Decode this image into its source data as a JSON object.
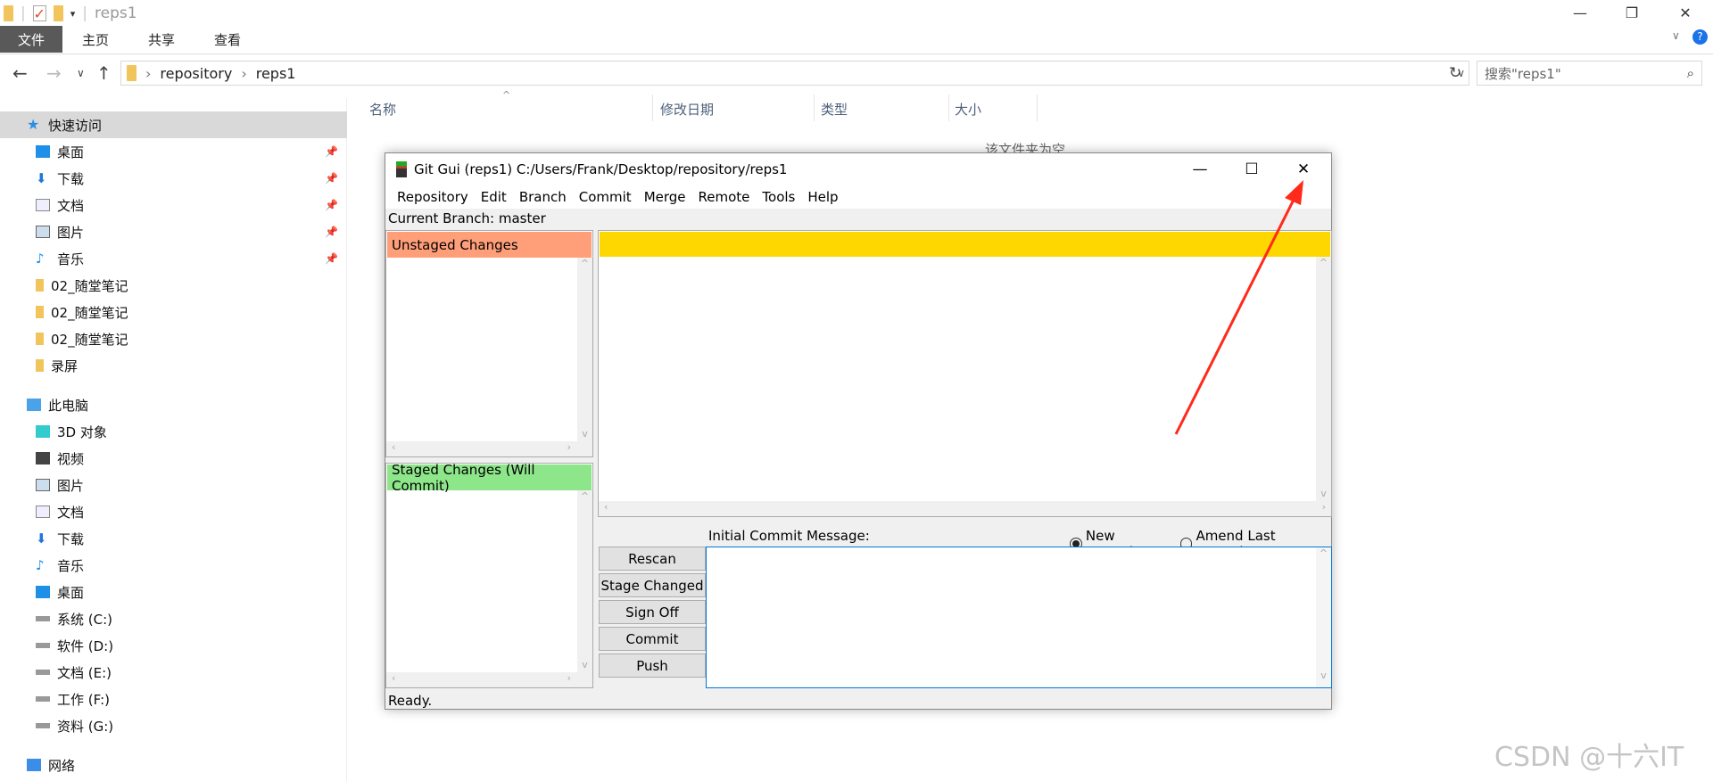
{
  "explorer": {
    "title": "reps1",
    "ribbon_tabs": [
      "文件",
      "主页",
      "共享",
      "查看"
    ],
    "breadcrumb": [
      "repository",
      "reps1"
    ],
    "search_placeholder": "搜索\"reps1\"",
    "sidebar": [
      {
        "label": "快速访问",
        "icon": "star-icon",
        "selected": true,
        "group": true
      },
      {
        "label": "桌面",
        "icon": "desktop-icon",
        "pinned": true
      },
      {
        "label": "下载",
        "icon": "download-icon",
        "pinned": true
      },
      {
        "label": "文档",
        "icon": "document-icon",
        "pinned": true
      },
      {
        "label": "图片",
        "icon": "picture-icon",
        "pinned": true
      },
      {
        "label": "音乐",
        "icon": "music-icon",
        "pinned": true
      },
      {
        "label": "02_随堂笔记",
        "icon": "folder-icon"
      },
      {
        "label": "02_随堂笔记",
        "icon": "folder-icon"
      },
      {
        "label": "02_随堂笔记",
        "icon": "folder-icon"
      },
      {
        "label": "录屏",
        "icon": "folder-icon"
      },
      {
        "label": "此电脑",
        "icon": "computer-icon",
        "group": true
      },
      {
        "label": "3D 对象",
        "icon": "cube-icon"
      },
      {
        "label": "视频",
        "icon": "video-icon"
      },
      {
        "label": "图片",
        "icon": "picture-icon"
      },
      {
        "label": "文档",
        "icon": "document-icon"
      },
      {
        "label": "下载",
        "icon": "download-icon"
      },
      {
        "label": "音乐",
        "icon": "music-icon"
      },
      {
        "label": "桌面",
        "icon": "desktop-icon"
      },
      {
        "label": "系统 (C:)",
        "icon": "drive-icon"
      },
      {
        "label": "软件 (D:)",
        "icon": "drive-icon"
      },
      {
        "label": "文档 (E:)",
        "icon": "drive-icon"
      },
      {
        "label": "工作 (F:)",
        "icon": "drive-icon"
      },
      {
        "label": "资料 (G:)",
        "icon": "drive-icon"
      },
      {
        "label": "网络",
        "icon": "network-icon",
        "group": true
      }
    ],
    "columns": [
      "名称",
      "修改日期",
      "类型",
      "大小"
    ],
    "empty_text": "该文件夹为空"
  },
  "git_gui": {
    "title": "Git Gui (reps1) C:/Users/Frank/Desktop/repository/reps1",
    "menu": [
      "Repository",
      "Edit",
      "Branch",
      "Commit",
      "Merge",
      "Remote",
      "Tools",
      "Help"
    ],
    "current_branch": "Current Branch: master",
    "unstaged_label": "Unstaged Changes",
    "staged_label": "Staged Changes (Will Commit)",
    "commit_message_label": "Initial Commit Message:",
    "radio_new": "New Commit",
    "radio_amend": "Amend Last Commit",
    "selected_mode": "New Commit",
    "buttons": [
      "Rescan",
      "Stage Changed",
      "Sign Off",
      "Commit",
      "Push"
    ],
    "status": "Ready.",
    "colors": {
      "unstaged": "#ff9f7a",
      "staged": "#8ee68a",
      "diff_header": "#ffd700",
      "arrow": "#ff2a1a"
    }
  },
  "watermark": "CSDN @十六IT"
}
